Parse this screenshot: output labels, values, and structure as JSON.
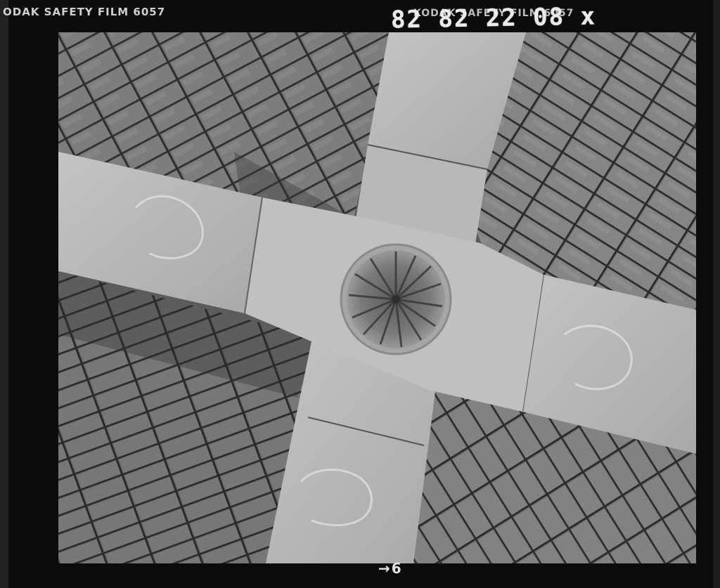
{
  "film_edge": {
    "left_print": "ODAK SAFETY FILM 6057",
    "right_print": "KODAK SAFETY FILM 6057",
    "handwritten_code": "82 82 22 08 x",
    "frame_number": "6",
    "frame_arrow": "→"
  },
  "photo": {
    "subject": "cross-vault-keystone-rosette",
    "colors": {
      "stone_light": "#bdbdbd",
      "stone_mid": "#8a8a8a",
      "shadow": "#3a3a3a"
    }
  }
}
